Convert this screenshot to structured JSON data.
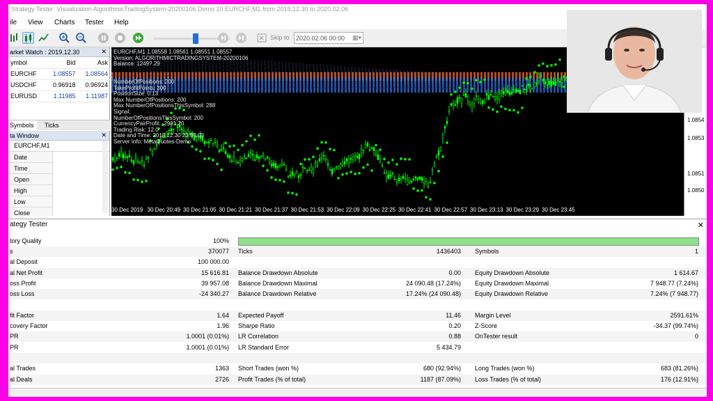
{
  "title": "Strategy Tester: Visualization AlgorithmicTradingSystem-20200106 Demo 10 EURCHF,M1 from 2019.12.30 to 2020.02.06",
  "menu": [
    "ile",
    "View",
    "Charts",
    "Tester",
    "Help"
  ],
  "toolbar": {
    "skip_label": "Skip to",
    "skip_value": "2020.02.06 00:00",
    "slider_value": 55
  },
  "market_watch": {
    "title": "arket Watch : 2019.12.30",
    "headers": [
      "ymbol",
      "Bid",
      "Ask"
    ],
    "rows": [
      {
        "symbol": "EURCHF",
        "bid": "1.08557",
        "ask": "1.08564"
      },
      {
        "symbol": "USDCHF",
        "bid": "0.96918",
        "ask": "0.96924"
      },
      {
        "symbol": "EURUSD",
        "bid": "1.11985",
        "ask": "1.11987"
      }
    ]
  },
  "tabs": [
    "Symbols",
    "Ticks"
  ],
  "data_window": {
    "title": "ta Window",
    "symbol": "EURCHF,M1",
    "rows": [
      "Date",
      "Time",
      "Open",
      "High",
      "Low",
      "Close"
    ]
  },
  "chart_info": [
    "EURCHF,M1  1.08558 1.08561 1.08551 1.08557",
    "Version: ALGORITHMICTRADINGSYSTEM-20200106",
    "Balance: 1249?.29",
    "",
    "",
    "NumberOfPositions: 200",
    "TakeProfitPoints: 300",
    "PositionSize: 0.13",
    "Max NumberOfPositions: 200",
    "Max NumberOfPositionsThisSymbol: 288",
    "Signal: ",
    "NumberOfPositionsThisSymbol: 200",
    "CurrencyPairProfit: -2981.20",
    "Trading Risk: 12.0",
    "Date and Time: 2019.12.30 23:59:00",
    "Server Info: MetaQuotes-Demo"
  ],
  "x_labels": [
    "30 Dec 2019",
    "30 Dec 20:49",
    "30 Dec 21:05",
    "30 Dec 21:21",
    "30 Dec 21:37",
    "30 Dec 21:53",
    "30 Dec 22:09",
    "30 Dec 22:25",
    "30 Dec 22:41",
    "30 Dec 22:57",
    "30 Dec 23:13",
    "30 Dec 23:29",
    "30 Dec 23:45"
  ],
  "y_labels": [
    "1.0854",
    "1.0853",
    "1.0851",
    "1.0850"
  ],
  "tester": {
    "title": "ategy Tester",
    "quality_label": "tory Quality",
    "quality_value": "100%",
    "quality_fraction": 1.0,
    "rows": [
      {
        "l1": "s",
        "v1": "370077",
        "l2": "Ticks",
        "v2": "1436403",
        "l3": "Symbols",
        "v3": "1"
      },
      {
        "l1": "al Deposit",
        "v1": "100 000.00",
        "l2": "",
        "v2": "",
        "l3": "",
        "v3": ""
      },
      {
        "l1": "al Net Profit",
        "v1": "15 616.81",
        "l2": "Balance Drawdown Absolute",
        "v2": "0.00",
        "l3": "Equity Drawdown Absolute",
        "v3": "1 614.67"
      },
      {
        "l1": "oss Profit",
        "v1": "39 957.08",
        "l2": "Balance Drawdown Maximal",
        "v2": "24 090.48 (17.24%)",
        "l3": "Equity Drawdown Maximal",
        "v3": "7 948.77 (7.24%)"
      },
      {
        "l1": "oss Loss",
        "v1": "-24 340.27",
        "l2": "Balance Drawdown Relative",
        "v2": "17.24% (24 090.48)",
        "l3": "Equity Drawdown Relative",
        "v3": "7.24% (7 948.77)"
      },
      {
        "l1": "",
        "v1": "",
        "l2": "",
        "v2": "",
        "l3": "",
        "v3": ""
      },
      {
        "l1": "fit Factor",
        "v1": "1.64",
        "l2": "Expected Payoff",
        "v2": "11.46",
        "l3": "Margin Level",
        "v3": "2591.61%"
      },
      {
        "l1": "covery Factor",
        "v1": "1.96",
        "l2": "Sharpe Ratio",
        "v2": "0.20",
        "l3": "Z-Score",
        "v3": "-34.37 (99.74%)"
      },
      {
        "l1": "PR",
        "v1": "1.0001 (0.01%)",
        "l2": "LR Correlation",
        "v2": "0.88",
        "l3": "OnTester result",
        "v3": "0"
      },
      {
        "l1": "PR",
        "v1": "1.0001 (0.01%)",
        "l2": "LR Standard Error",
        "v2": "5 434.79",
        "l3": "",
        "v3": ""
      },
      {
        "l1": "",
        "v1": "",
        "l2": "",
        "v2": "",
        "l3": "",
        "v3": ""
      },
      {
        "l1": "al Trades",
        "v1": "1363",
        "l2": "Short Trades (won %)",
        "v2": "680 (92.94%)",
        "l3": "Long Trades (won %)",
        "v3": "683 (81.26%)"
      },
      {
        "l1": "al Deals",
        "v1": "2726",
        "l2": "Profit Trades (% of total)",
        "v2": "1187 (87.09%)",
        "l3": "Loss Trades (% of total)",
        "v3": "176 (12.91%)"
      }
    ]
  },
  "colors": {
    "bull": "#00ff00",
    "bear": "#00ff00",
    "sar": "#00ff00",
    "tp": "#ff6a2a",
    "sl": "#2e6fe0",
    "frame": "#ff00e6"
  }
}
